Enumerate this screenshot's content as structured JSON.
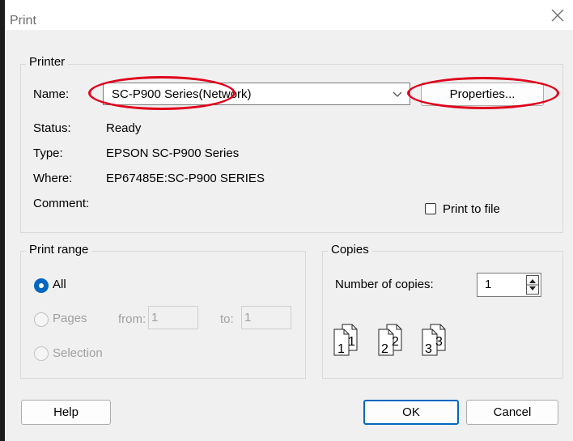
{
  "dialog": {
    "title": "Print"
  },
  "printer": {
    "group_label": "Printer",
    "name_label": "Name:",
    "name_value": "SC-P900 Series(Network)",
    "properties_label": "Properties...",
    "status_label": "Status:",
    "status_value": "Ready",
    "type_label": "Type:",
    "type_value": "EPSON SC-P900 Series",
    "where_label": "Where:",
    "where_value": "EP67485E:SC-P900 SERIES",
    "comment_label": "Comment:",
    "print_to_file_label": "Print to file",
    "print_to_file_checked": false
  },
  "print_range": {
    "group_label": "Print range",
    "all_label": "All",
    "pages_label": "Pages",
    "from_label": "from:",
    "from_value": "1",
    "to_label": "to:",
    "to_value": "1",
    "selection_label": "Selection",
    "selected": "All"
  },
  "copies": {
    "group_label": "Copies",
    "number_label": "Number of copies:",
    "number_value": "1",
    "collate_pages": [
      "1",
      "1",
      "2",
      "2",
      "3",
      "3"
    ]
  },
  "buttons": {
    "help": "Help",
    "ok": "OK",
    "cancel": "Cancel"
  },
  "colors": {
    "annotation": "#e0001b",
    "radio_selected": "#0067c0",
    "dialog_bg": "#f0f0f0"
  }
}
